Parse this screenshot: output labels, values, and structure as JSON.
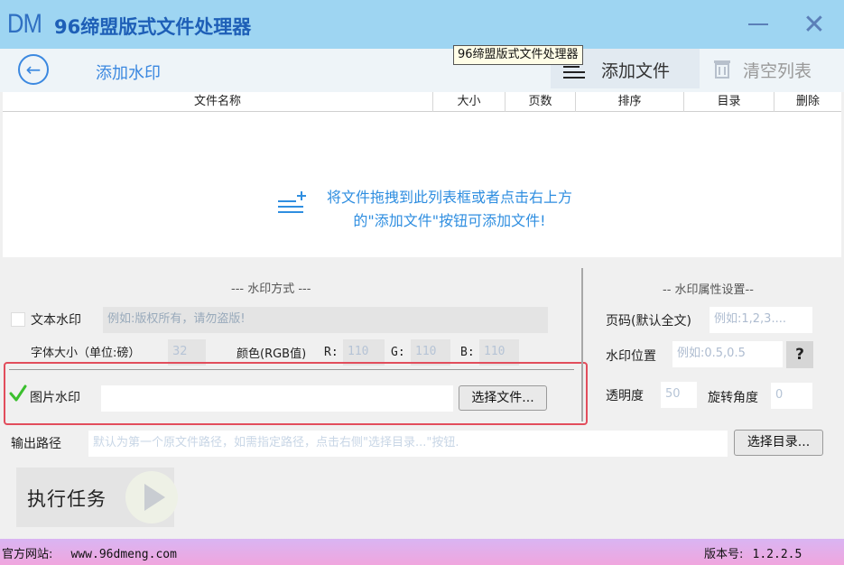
{
  "app": {
    "logo": "DM",
    "title": "96缔盟版式文件处理器"
  },
  "window_buttons": {
    "minimize": "—",
    "close": "✕"
  },
  "toolbar": {
    "back_icon": "←",
    "section_title": "添加水印",
    "add_file_label": "添加文件",
    "clear_list_label": "清空列表"
  },
  "tooltip": {
    "text": "96缔盟版式文件处理器"
  },
  "table": {
    "columns": [
      "文件名称",
      "大小",
      "页数",
      "排序",
      "目录",
      "删除"
    ],
    "empty_hint_line1": "将文件拖拽到此列表框或者点击右上方",
    "empty_hint_line2": "的\"添加文件\"按钮可添加文件!"
  },
  "watermark_mode": {
    "group_label": "--- 水印方式 ---",
    "text_watermark_label": "文本水印",
    "text_watermark_placeholder": "例如:版权所有，请勿盗版!",
    "font_size_label": "字体大小（单位:磅）",
    "font_size_value": "32",
    "color_label": "颜色(RGB值)",
    "r_label": "R:",
    "r_value": "110",
    "g_label": "G:",
    "g_value": "110",
    "b_label": "B:",
    "b_value": "110",
    "image_watermark_label": "图片水印",
    "image_watermark_checked": true,
    "image_path_value": "",
    "choose_file_label": "选择文件..."
  },
  "watermark_props": {
    "group_label": "-- 水印属性设置--",
    "page_label": "页码(默认全文)",
    "page_placeholder": "例如:1,2,3....",
    "position_label": "水印位置",
    "position_placeholder": "例如:0.5,0.5",
    "help_label": "?",
    "opacity_label": "透明度",
    "opacity_value": "50",
    "rotation_label": "旋转角度",
    "rotation_value": "0"
  },
  "output": {
    "label": "输出路径",
    "placeholder": "默认为第一个原文件路径，如需指定路径，点击右侧\"选择目录...\"按钮.",
    "choose_dir_label": "选择目录..."
  },
  "run": {
    "label": "执行任务"
  },
  "status": {
    "website_label": "官方网站:",
    "website_url": "www.96dmeng.com",
    "version_label": "版本号:",
    "version_value": "1.2.2.5"
  },
  "colors": {
    "titlebar": "#9ed5f2",
    "accent": "#3b88e0",
    "check_green": "#3bbf2e",
    "highlight_red": "#e24d5c"
  }
}
